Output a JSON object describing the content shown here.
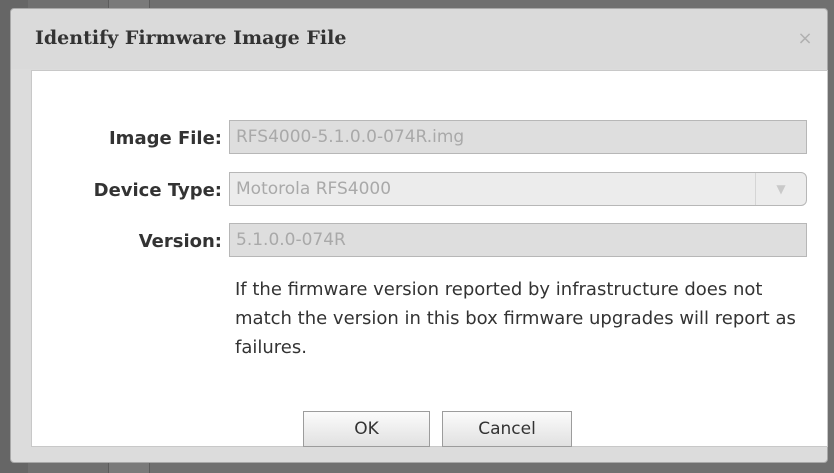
{
  "dialog": {
    "title": "Identify Firmware Image File",
    "close_symbol": "×"
  },
  "form": {
    "image_file": {
      "label": "Image File:",
      "value": "RFS4000-5.1.0.0-074R.img"
    },
    "device_type": {
      "label": "Device Type:",
      "value": "Motorola RFS4000",
      "arrow": "▼"
    },
    "version": {
      "label": "Version:",
      "value": "5.1.0.0-074R"
    },
    "note": "If the firmware version reported by infrastructure does not match the version in this box firmware upgrades will report as failures."
  },
  "buttons": {
    "ok": "OK",
    "cancel": "Cancel"
  }
}
